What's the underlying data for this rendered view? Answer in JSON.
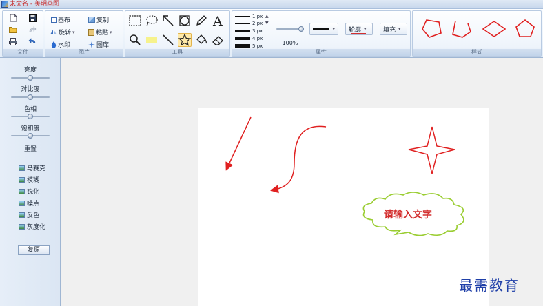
{
  "window": {
    "title": "未命名 - 美明画图"
  },
  "ribbon": {
    "groups": {
      "file": "文件",
      "image": "图片",
      "tools": "工具",
      "properties": "属性",
      "styles": "样式"
    },
    "image_buttons": {
      "canvas": "画布",
      "copy": "复制",
      "rotate": "旋转",
      "paste": "粘贴",
      "watermark": "水印",
      "gallery": "图库"
    },
    "line_widths": [
      "1 px",
      "2 px",
      "3 px",
      "4 px",
      "5 px"
    ],
    "zoom": "100%",
    "outline_label": "轮廓",
    "fill_label": "填充"
  },
  "left_panel": {
    "adjustments": [
      "亮度",
      "对比度",
      "色相",
      "饱和度"
    ],
    "adjustment_levels": [
      0.5,
      0.5,
      0.5,
      0.5
    ],
    "sharpness_label": "重置",
    "effects": [
      "马赛克",
      "模糊",
      "锐化",
      "噪点",
      "反色",
      "灰度化"
    ],
    "reset_button": "复原"
  },
  "canvas": {
    "bubble_text": "请输入文字",
    "stroke_color": "#e02020",
    "bubble_color": "#9acd32"
  },
  "watermark": "最需教育"
}
